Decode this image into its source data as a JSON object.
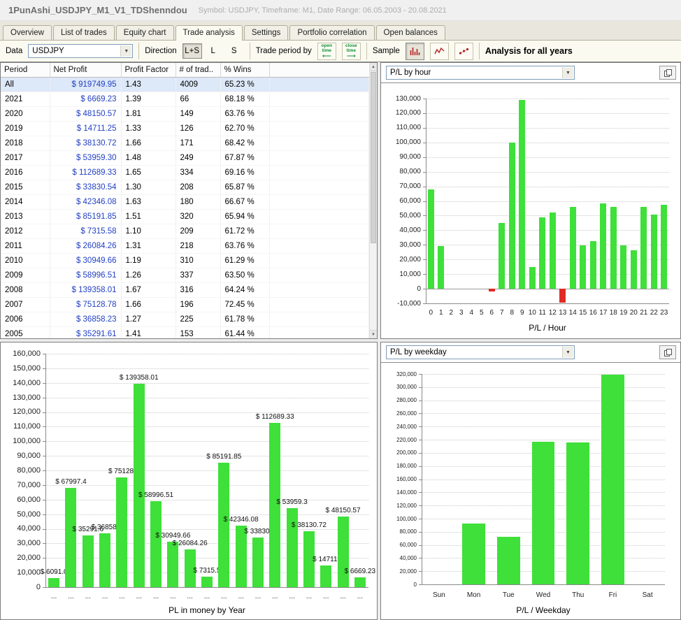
{
  "window": {
    "title": "1PunAshi_USDJPY_M1_V1_TDShenndou",
    "subtitle": "Symbol: USDJPY, Timeframe: M1, Date Range: 06.05.2003 - 20.08.2021"
  },
  "tabs": [
    {
      "label": "Overview",
      "active": false
    },
    {
      "label": "List of trades",
      "active": false
    },
    {
      "label": "Equity chart",
      "active": false
    },
    {
      "label": "Trade analysis",
      "active": true
    },
    {
      "label": "Settings",
      "active": false
    },
    {
      "label": "Portfolio correlation",
      "active": false
    },
    {
      "label": "Open balances",
      "active": false
    }
  ],
  "icons": {
    "chevron_down": "▼",
    "arrow_left": "⟵",
    "arrow_right": "⟶",
    "scroll_up": "▲",
    "scroll_down": "▼"
  },
  "toolbar": {
    "data_label": "Data",
    "data_value": "USDJPY",
    "direction_label": "Direction",
    "direction_options": [
      "L+S",
      "L",
      "S"
    ],
    "direction_selected": "L+S",
    "trade_period_label": "Trade period by",
    "open_time_word1": "open",
    "open_time_word2": "time",
    "close_time_word1": "close",
    "close_time_word2": "time",
    "sample_label": "Sample",
    "analysis_label": "Analysis for all years"
  },
  "table": {
    "net_profit_color": "#2240c2",
    "columns": [
      "Period",
      "Net Profit",
      "Profit Factor",
      "# of trad..",
      "% Wins"
    ],
    "selected_row_index": 0,
    "rows": [
      [
        "All",
        "$ 919749.95",
        "1.43",
        "4009",
        "65.23 %"
      ],
      [
        "2021",
        "$ 6669.23",
        "1.39",
        "66",
        "68.18 %"
      ],
      [
        "2020",
        "$ 48150.57",
        "1.81",
        "149",
        "63.76 %"
      ],
      [
        "2019",
        "$ 14711.25",
        "1.33",
        "126",
        "62.70 %"
      ],
      [
        "2018",
        "$ 38130.72",
        "1.66",
        "171",
        "68.42 %"
      ],
      [
        "2017",
        "$ 53959.30",
        "1.48",
        "249",
        "67.87 %"
      ],
      [
        "2016",
        "$ 112689.33",
        "1.65",
        "334",
        "69.16 %"
      ],
      [
        "2015",
        "$ 33830.54",
        "1.30",
        "208",
        "65.87 %"
      ],
      [
        "2014",
        "$ 42346.08",
        "1.63",
        "180",
        "66.67 %"
      ],
      [
        "2013",
        "$ 85191.85",
        "1.51",
        "320",
        "65.94 %"
      ],
      [
        "2012",
        "$ 7315.58",
        "1.10",
        "209",
        "61.72 %"
      ],
      [
        "2011",
        "$ 26084.26",
        "1.31",
        "218",
        "63.76 %"
      ],
      [
        "2010",
        "$ 30949.66",
        "1.19",
        "310",
        "61.29 %"
      ],
      [
        "2009",
        "$ 58996.51",
        "1.26",
        "337",
        "63.50 %"
      ],
      [
        "2008",
        "$ 139358.01",
        "1.67",
        "316",
        "64.24 %"
      ],
      [
        "2007",
        "$ 75128.78",
        "1.66",
        "196",
        "72.45 %"
      ],
      [
        "2006",
        "$ 36858.23",
        "1.27",
        "225",
        "61.78 %"
      ],
      [
        "2005",
        "$ 35291.61",
        "1.41",
        "153",
        "61.44 %"
      ]
    ]
  },
  "panels": {
    "hour_selector": "P/L by hour",
    "weekday_selector": "P/L by weekday"
  },
  "chart_data": [
    {
      "type": "bar",
      "title": "P/L by hour",
      "xlabel": "P/L / Hour",
      "categories": [
        "0",
        "1",
        "2",
        "3",
        "4",
        "5",
        "6",
        "7",
        "8",
        "9",
        "10",
        "11",
        "12",
        "13",
        "14",
        "15",
        "16",
        "17",
        "18",
        "19",
        "20",
        "21",
        "22",
        "23"
      ],
      "values": [
        68000,
        29000,
        0,
        0,
        0,
        0,
        -2000,
        45000,
        100000,
        129000,
        15000,
        49000,
        52000,
        -9500,
        56000,
        29500,
        32500,
        58500,
        56000,
        29500,
        26500,
        56000,
        50500,
        57500
      ],
      "ylim": [
        -10000,
        130000
      ],
      "ystep": 10000,
      "grid": true,
      "bar_color": "#3ee039",
      "neg_color": "#e02b25"
    },
    {
      "type": "bar",
      "title": "PL in money by Year",
      "xlabel": "PL in money by Year",
      "categories": [
        "...",
        "...",
        "...",
        "...",
        "...",
        "...",
        "...",
        "...",
        "...",
        "...",
        "...",
        "...",
        "...",
        "...",
        "...",
        "...",
        "...",
        "...",
        "..."
      ],
      "values": [
        6091.0,
        67997.4,
        35291.61,
        36858.23,
        75128.78,
        139358.01,
        58996.51,
        30949.66,
        26084.26,
        7315.58,
        85191.85,
        42346.08,
        33830.54,
        112689.33,
        53959.3,
        38130.72,
        14711.25,
        48150.57,
        6669.23
      ],
      "bar_labels": [
        "$ 6091.0",
        "$ 67997.4",
        "$ 35291.6",
        "$ 36858.",
        "$ 75128.",
        "$ 139358.01",
        "$ 58996.51",
        "$ 30949.66",
        "$ 26084.26",
        "$ 7315.5",
        "$ 85191.85",
        "$ 42346.08",
        "$ 33830.",
        "$ 112689.33",
        "$ 53959.3",
        "$ 38130.72",
        "$ 14711.",
        "$ 48150.57",
        "$ 6669.23"
      ],
      "ylim": [
        0,
        160000
      ],
      "ystep": 10000,
      "grid": true,
      "bar_color": "#3ee039",
      "neg_color": "#e02b25"
    },
    {
      "type": "bar",
      "title": "P/L by weekday",
      "xlabel": "P/L / Weekday",
      "categories": [
        "Sun",
        "Mon",
        "Tue",
        "Wed",
        "Thu",
        "Fri",
        "Sat"
      ],
      "values": [
        0,
        93000,
        72000,
        217000,
        216000,
        319000,
        0
      ],
      "ylim": [
        0,
        320000
      ],
      "ystep": 20000,
      "grid": true,
      "bar_color": "#3ee039",
      "neg_color": "#e02b25"
    }
  ]
}
